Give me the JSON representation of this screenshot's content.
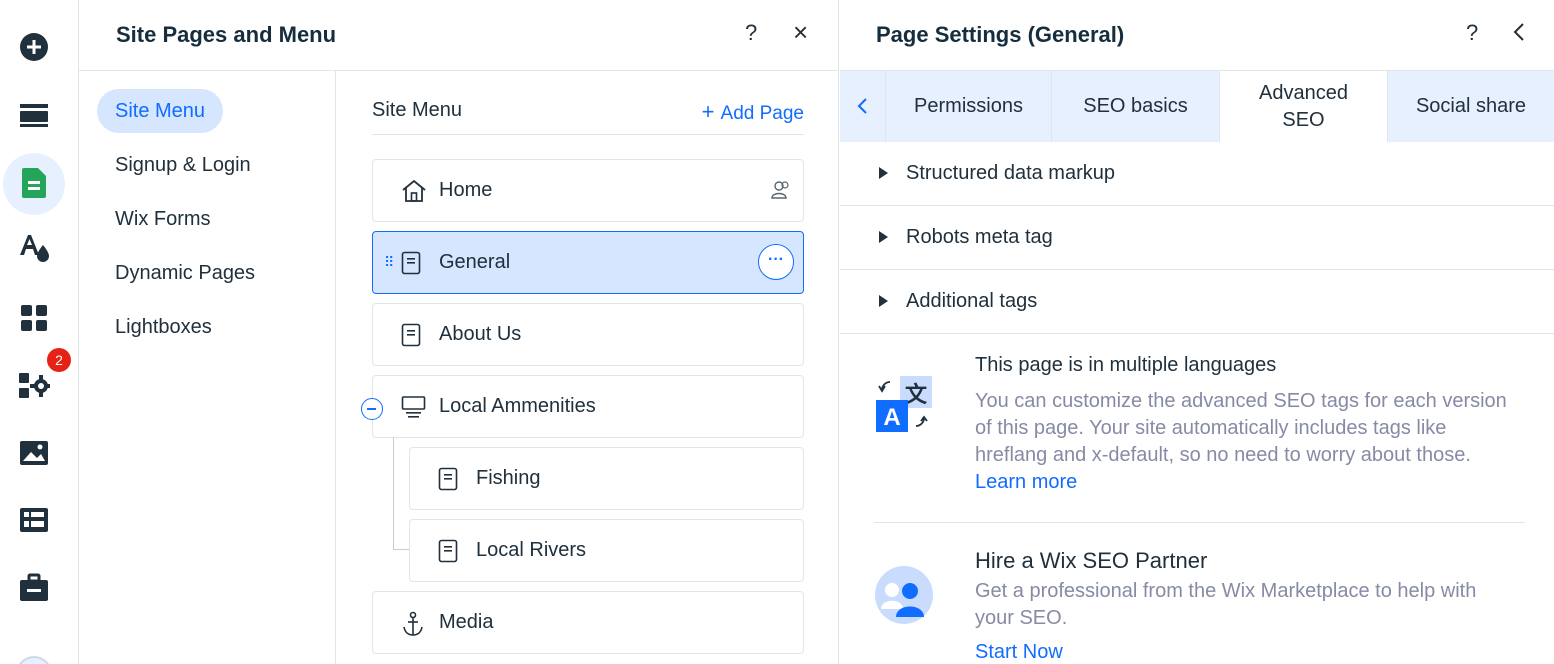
{
  "rail": {
    "badge_count": "2",
    "icons": [
      "add-icon",
      "sections-icon",
      "pages-icon",
      "theme-icon",
      "apps-icon",
      "business-apps-icon",
      "media-icon",
      "cms-icon",
      "portfolio-icon"
    ]
  },
  "site_pages": {
    "title": "Site Pages and Menu",
    "help": "?",
    "close": "×",
    "categories": [
      "Site Menu",
      "Signup & Login",
      "Wix Forms",
      "Dynamic Pages",
      "Lightboxes"
    ],
    "list_title": "Site Menu",
    "add_page_label": "Add Page",
    "pages": [
      {
        "label": "Home",
        "icon": "home-icon"
      },
      {
        "label": "General",
        "icon": "page-icon",
        "selected": true
      },
      {
        "label": "About Us",
        "icon": "page-icon"
      },
      {
        "label": "Local Ammenities",
        "icon": "folder-icon"
      },
      {
        "label": "Fishing",
        "icon": "page-icon",
        "subpage": true
      },
      {
        "label": "Local Rivers",
        "icon": "page-icon",
        "subpage": true
      },
      {
        "label": "Media",
        "icon": "anchor-icon"
      }
    ],
    "more": "···"
  },
  "page_settings": {
    "title": "Page Settings (General)",
    "help": "?",
    "tabs": [
      "Permissions",
      "SEO basics",
      "Advanced SEO",
      "Social share"
    ],
    "active_tab": "Advanced SEO",
    "sections": [
      "Structured data markup",
      "Robots meta tag",
      "Additional tags"
    ],
    "languages": {
      "title": "This page is in multiple languages",
      "body": "You can customize the advanced SEO tags for each version of this page. Your site automatically includes tags like hreflang and x-default, so no need to worry about those.",
      "link": "Learn more"
    },
    "partner": {
      "title": "Hire a Wix SEO Partner",
      "body": "Get a professional from the Wix Marketplace to help with your SEO.",
      "link": "Start Now"
    }
  },
  "colors": {
    "accent": "#116dff",
    "selected_bg": "#d6e6fe",
    "text": "#20303c",
    "muted": "#868aa5",
    "badge": "#e62214",
    "pages_icon": "#25a55a"
  }
}
